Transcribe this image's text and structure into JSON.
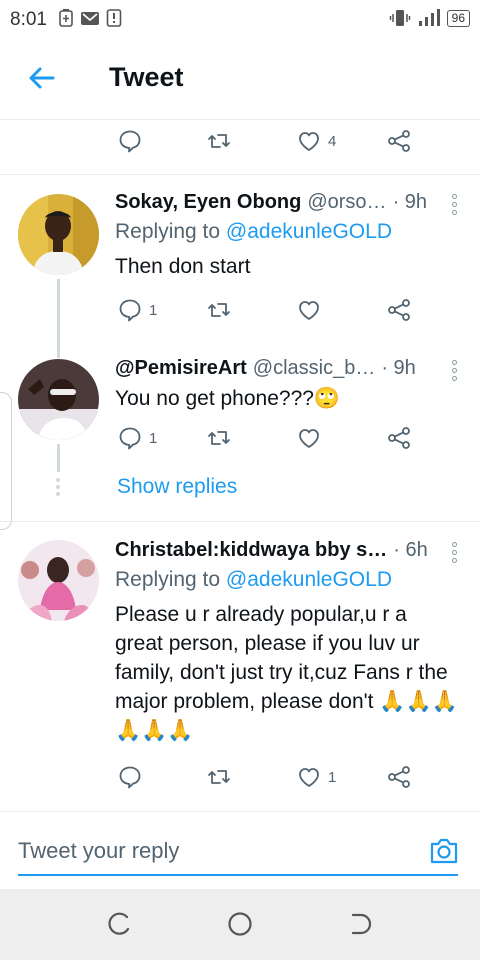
{
  "status_bar": {
    "time": "8:01",
    "battery": "96",
    "icons": [
      "battery-saver-icon",
      "gmail-icon",
      "notification-icon",
      "vibrate-icon",
      "signal-icon"
    ]
  },
  "header": {
    "title": "Tweet"
  },
  "top_actions": {
    "like_count": "4"
  },
  "tweets": [
    {
      "name": "Sokay, Eyen Obong",
      "handle": "@orso…",
      "time": "· 9h",
      "replying_prefix": "Replying to ",
      "replying_to": "@adekunleGOLD",
      "text": "Then don start",
      "reply_count": "1",
      "retweet_count": "",
      "like_count": ""
    },
    {
      "name": "@PemisireArt",
      "handle": "@classic_b…",
      "time": "· 9h",
      "text": "You no get phone???🙄",
      "reply_count": "1",
      "retweet_count": "",
      "like_count": ""
    },
    {
      "name": "Christabel:kiddwaya bby s…",
      "handle": "",
      "time": "· 6h",
      "replying_prefix": "Replying to ",
      "replying_to": "@adekunleGOLD",
      "text": "Please u r already popular,u r a great person, please if you luv ur family, don't just try it,cuz Fans r the major problem, please don't 🙏🙏🙏🙏🙏🙏",
      "reply_count": "",
      "retweet_count": "",
      "like_count": "1"
    }
  ],
  "show_replies": "Show replies",
  "reply_bar": {
    "placeholder": "Tweet your reply"
  },
  "colors": {
    "accent": "#1d9bf0",
    "text": "#0f1419",
    "secondary": "#536471",
    "divider": "#e6ecf0"
  }
}
